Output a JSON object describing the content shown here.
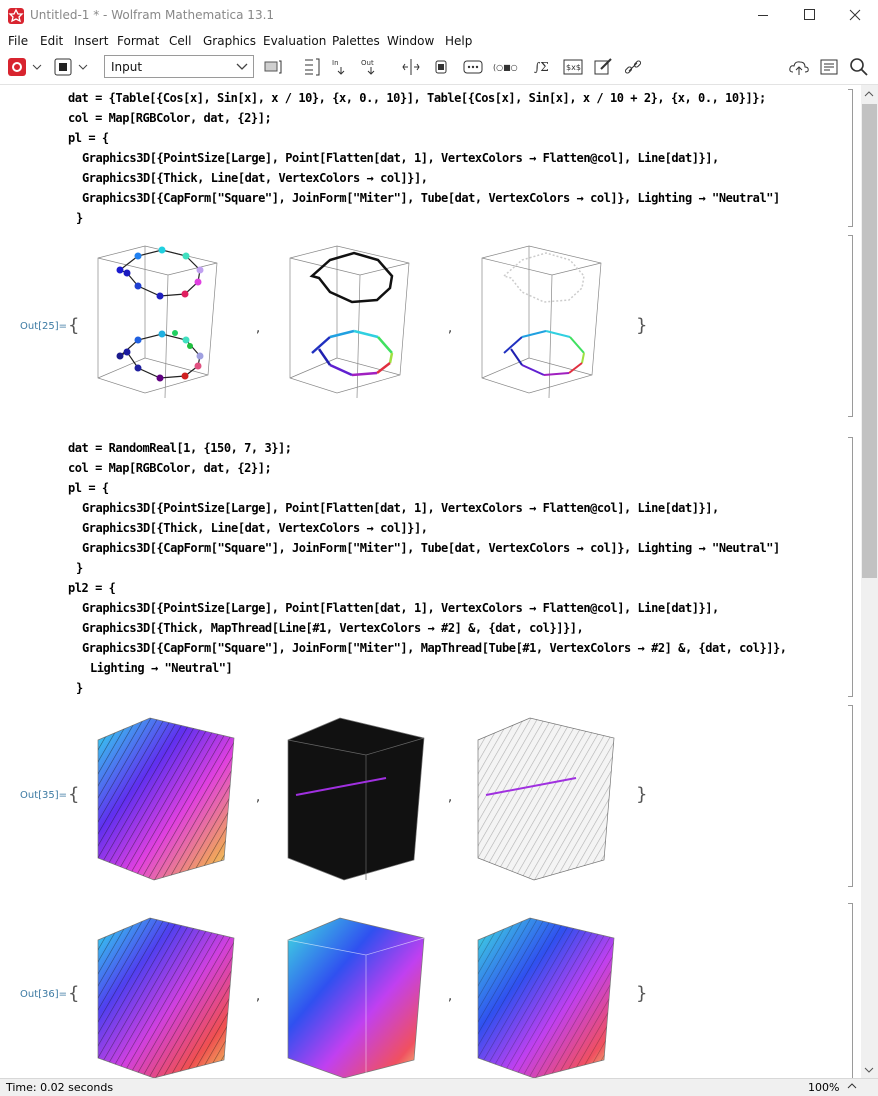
{
  "window": {
    "title": "Untitled-1 * - Wolfram Mathematica 13.1"
  },
  "menu": [
    "File",
    "Edit",
    "Insert",
    "Format",
    "Cell",
    "Graphics",
    "Evaluation",
    "Palettes",
    "Window",
    "Help"
  ],
  "toolbar": {
    "style_value": "Input",
    "in_label": "In",
    "out_label": "Out"
  },
  "cell1": {
    "lines": [
      "dat = {Table[{Cos[x], Sin[x], x / 10}, {x, 0., 10}], Table[{Cos[x], Sin[x], x / 10 + 2}, {x, 0., 10}]};",
      "col = Map[RGBColor, dat, {2}];",
      "pl = {",
      "Graphics3D[{PointSize[Large], Point[Flatten[dat, 1], VertexColors → Flatten@col], Line[dat]}],",
      "Graphics3D[{Thick, Line[dat, VertexColors → col]}],",
      "Graphics3D[{CapForm[\"Square\"], JoinForm[\"Miter\"], Tube[dat, VertexColors → col]}, Lighting → \"Neutral\"]",
      "}"
    ],
    "out_label": "Out[25]="
  },
  "cell2": {
    "lines": [
      "dat = RandomReal[1, {150, 7, 3}];",
      "col = Map[RGBColor, dat, {2}];",
      "pl = {",
      "Graphics3D[{PointSize[Large], Point[Flatten[dat, 1], VertexColors → Flatten@col], Line[dat]}],",
      "Graphics3D[{Thick, Line[dat, VertexColors → col]}],",
      "Graphics3D[{CapForm[\"Square\"], JoinForm[\"Miter\"], Tube[dat, VertexColors → col]}, Lighting → \"Neutral\"]",
      "}",
      "pl2 = {",
      "Graphics3D[{PointSize[Large], Point[Flatten[dat, 1], VertexColors → Flatten@col], Line[dat]}],",
      "Graphics3D[{Thick, MapThread[Line[#1, VertexColors → #2] &, {dat, col}]}],",
      "Graphics3D[{CapForm[\"Square\"], JoinForm[\"Miter\"], MapThread[Tube[#1, VertexColors → #2] &, {dat, col}]},",
      "Lighting → \"Neutral\"]",
      "}"
    ],
    "out_label_a": "Out[35]=",
    "out_label_b": "Out[36]="
  },
  "punct": {
    "open": "{",
    "close": "}",
    "comma": ","
  },
  "status": {
    "text": "Time: 0.02 seconds",
    "zoom": "100%"
  }
}
